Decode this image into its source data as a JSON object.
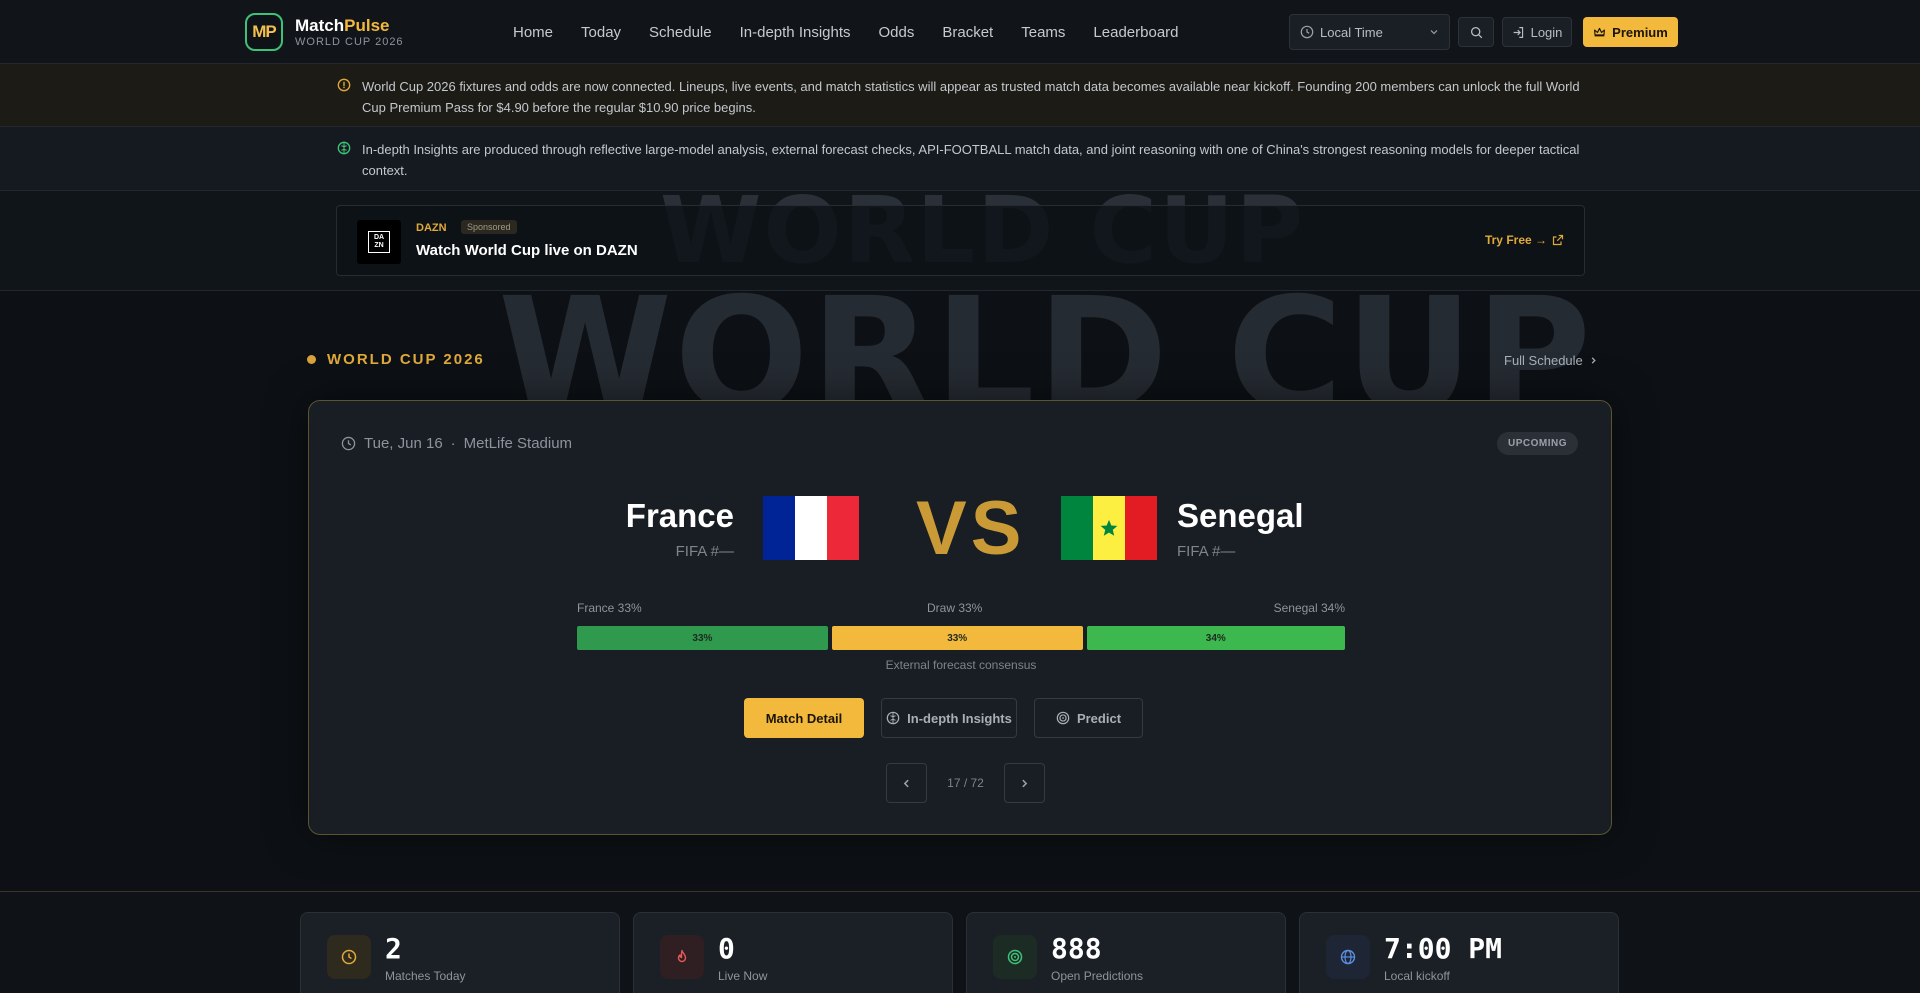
{
  "brand": {
    "logo_letters": "MP",
    "name_a": "Match",
    "name_b": "Pulse",
    "subtitle": "WORLD CUP 2026"
  },
  "nav": {
    "links": [
      "Home",
      "Today",
      "Schedule",
      "In-depth Insights",
      "Odds",
      "Bracket",
      "Teams",
      "Leaderboard"
    ],
    "time_select": "Local Time",
    "login": "Login",
    "premium": "Premium"
  },
  "notices": [
    {
      "text": "World Cup 2026 fixtures and odds are now connected. Lineups, live events, and match statistics will appear as trusted match data becomes available near kickoff. Founding 200 members can unlock the full World Cup Premium Pass for $4.90 before the regular $10.90 price begins.",
      "color": "#e0a93a"
    },
    {
      "text": "In-depth Insights are produced through reflective large-model analysis, external forecast checks, API-FOOTBALL match data, and joint reasoning with one of China's strongest reasoning models for deeper tactical context.",
      "color": "#3ec27a"
    }
  ],
  "ad": {
    "logo_text": "DAZN",
    "brand": "DAZN",
    "badge": "Sponsored",
    "title": "Watch World Cup live on DAZN",
    "cta": "Try Free →"
  },
  "watermark": "WORLD CUP",
  "section": {
    "title": "WORLD CUP 2026",
    "full_schedule": "Full Schedule"
  },
  "match": {
    "date": "Tue, Jun 16",
    "venue": "MetLife Stadium",
    "status": "UPCOMING",
    "home": {
      "name": "France",
      "rank": "FIFA #—"
    },
    "away": {
      "name": "Senegal",
      "rank": "FIFA #—"
    },
    "vs": "VS",
    "odds": {
      "home_label": "France 33%",
      "draw_label": "Draw 33%",
      "away_label": "Senegal 34%",
      "home_pct": 33,
      "draw_pct": 33,
      "away_pct": 34,
      "home_text": "33%",
      "draw_text": "33%",
      "away_text": "34%",
      "caption": "External forecast consensus"
    },
    "actions": {
      "detail": "Match Detail",
      "insights": "In-depth Insights",
      "predict": "Predict"
    },
    "pager": "17 / 72"
  },
  "stats": [
    {
      "value": "2",
      "label": "Matches Today",
      "icon": "clock-icon",
      "color": "#e0a93a"
    },
    {
      "value": "0",
      "label": "Live Now",
      "icon": "flame-icon",
      "color": "#e35a5a"
    },
    {
      "value": "888",
      "label": "Open Predictions",
      "icon": "target-icon",
      "color": "#3ec27a"
    },
    {
      "value": "7:00 PM",
      "label": "Local kickoff",
      "icon": "globe-icon",
      "color": "#5a8fe3"
    }
  ],
  "colors": {
    "accent": "#f3b93d",
    "home_bar": "#2f9a4e",
    "draw_bar": "#f3b93d",
    "away_bar": "#3cb84f"
  }
}
